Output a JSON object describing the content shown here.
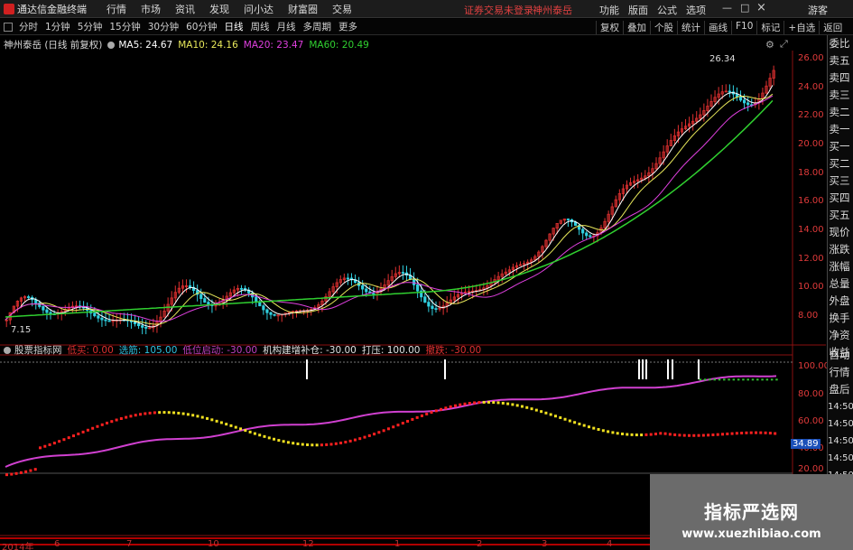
{
  "app": {
    "title": "通达信金融终端",
    "menu": [
      "行情",
      "市场",
      "资讯",
      "发现",
      "问小达",
      "财富圈",
      "交易"
    ],
    "notice": "证券交易未登录",
    "stock_link": "神州泰岳",
    "right_menu": [
      "功能",
      "版面",
      "公式",
      "选项"
    ],
    "user": "游客",
    "window_controls": {
      "minimize": "—",
      "maximize": "□",
      "close": "×"
    }
  },
  "toolbar": {
    "periods": [
      "分时",
      "1分钟",
      "5分钟",
      "15分钟",
      "30分钟",
      "60分钟",
      "日线",
      "周线",
      "月线",
      "多周期",
      "更多"
    ],
    "active_period": "日线",
    "actions": [
      "复权",
      "叠加",
      "个股",
      "统计",
      "画线",
      "F10",
      "标记",
      "+自选",
      "返回"
    ]
  },
  "main_chart": {
    "stock_label": "神州泰岳 (日线 前复权)",
    "ma": [
      {
        "label": "MA5: 24.67",
        "color": "#ffffff"
      },
      {
        "label": "MA10: 24.16",
        "color": "#e8e85a"
      },
      {
        "label": "MA20: 23.47",
        "color": "#e040e0"
      },
      {
        "label": "MA60: 20.49",
        "color": "#30d030"
      }
    ],
    "price_axis": [
      "26.00",
      "24.00",
      "22.00",
      "20.00",
      "18.00",
      "16.00",
      "14.00",
      "12.00",
      "10.00",
      "8.00"
    ],
    "high_label": "26.34",
    "low_label": "7.15"
  },
  "indicator": {
    "name": "股票指标网",
    "params": [
      {
        "label": "低买: 0.00",
        "color": "#e03030"
      },
      {
        "label": "选筋: 105.00",
        "color": "#30c0e0"
      },
      {
        "label": "低位启动: -30.00",
        "color": "#c040c0"
      },
      {
        "label": "机构建增补仓: -30.00",
        "color": "#e0e0e0"
      },
      {
        "label": "打压: 100.00",
        "color": "#e0e0e0"
      },
      {
        "label": "撤跌: -30.00",
        "color": "#e03030"
      }
    ],
    "axis": [
      "100.00",
      "80.00",
      "60.00",
      "40.00",
      "20.00"
    ],
    "current_value": "34.89"
  },
  "time_axis": [
    "2014年",
    "6",
    "7",
    "10",
    "12",
    "1",
    "2",
    "3",
    "4"
  ],
  "sidebar": {
    "items": [
      "委比",
      "卖五",
      "卖四",
      "卖三",
      "卖二",
      "卖一",
      "买一",
      "买二",
      "买三",
      "买四",
      "买五",
      "现价",
      "涨跌",
      "涨幅",
      "总量",
      "外盘",
      "换手",
      "净资",
      "收益"
    ],
    "lower": [
      "自动",
      "行情",
      "盘后",
      "14:50",
      "14:50",
      "14:50",
      "14:50",
      "14:50",
      "14:50",
      "14:50",
      "14:50"
    ]
  },
  "watermark": {
    "title": "指标严选网",
    "url": "www.xuezhibiao.com"
  },
  "colors": {
    "up": "#e03030",
    "down": "#30d0e0",
    "ma5": "#ffffff",
    "ma10": "#e8e85a",
    "ma20": "#e040e0",
    "ma60": "#30d030",
    "red_line": "#e00000"
  }
}
